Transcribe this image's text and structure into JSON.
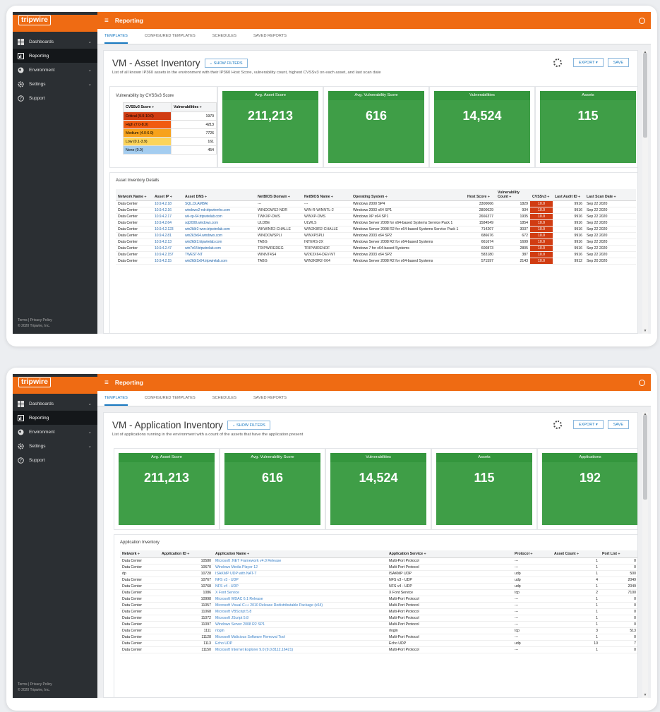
{
  "app": {
    "logo": "tripwire",
    "title": "Reporting",
    "brand_color": "#ef6b13",
    "sidebar": [
      {
        "label": "Dashboards",
        "icon": "dashboard-icon",
        "chevron": true
      },
      {
        "label": "Reporting",
        "icon": "report-icon",
        "chevron": false,
        "active": true
      },
      {
        "label": "Environment",
        "icon": "globe-icon",
        "chevron": true
      },
      {
        "label": "Settings",
        "icon": "gear-icon",
        "chevron": true
      },
      {
        "label": "Support",
        "icon": "help-icon",
        "chevron": false
      }
    ],
    "footer_links": "Terms | Privacy Policy",
    "footer_copy": "© 2020 Tripwire, Inc.",
    "tabs": [
      "TEMPLATES",
      "CONFIGURED TEMPLATES",
      "SCHEDULES",
      "SAVED REPORTS"
    ],
    "show_filters": "SHOW FILTERS",
    "export": "EXPORT",
    "save": "SAVE"
  },
  "report1": {
    "title": "VM - Asset Inventory",
    "description": "List of all known IP360 assets in the environment with their IP360 Host Score, vulnerability count, highest CVSSv3 on each asset, and last scan date",
    "cvss_title": "Vulnerability by CVSSv3 Score",
    "cvss_headers": [
      "CVSSv3 Score ÷",
      "Vulnerabilities ÷"
    ],
    "cvss_rows": [
      {
        "label": "Critical (9.0-10.0)",
        "value": "1970",
        "color": "#d13c12"
      },
      {
        "label": "High (7.0-8.9)",
        "value": "4213",
        "color": "#f15a10"
      },
      {
        "label": "Medium (4.0-6.9)",
        "value": "7726",
        "color": "#f7a21b"
      },
      {
        "label": "Low (0.1-3.9)",
        "value": "161",
        "color": "#fcd45a"
      },
      {
        "label": "None (0.0)",
        "value": "454",
        "color": "#a4cdf0"
      }
    ],
    "kpis": [
      {
        "label": "Avg. Asset Score",
        "value": "211,213"
      },
      {
        "label": "Avg. Vulnerability Score",
        "value": "616"
      },
      {
        "label": "Vulnerabilities",
        "value": "14,524"
      },
      {
        "label": "Assets",
        "value": "115"
      }
    ],
    "details_title": "Asset Inventory Details",
    "headers": [
      "Network Name ÷",
      "Asset IP ÷",
      "Asset DNS ÷",
      "NetBIOS Domain ÷",
      "NetBIOS Name ÷",
      "Operating System ÷",
      "Host Score ÷",
      "Vulnerability Count ÷",
      "CVSSv3 ÷",
      "Last Audit ID ÷",
      "Last Scan Date ÷"
    ],
    "rows": [
      [
        "Data Center",
        "10.9.4.2.18",
        "SQL.DLAMBAI",
        "---",
        "---",
        "Windows 2000 SP4",
        "3300066",
        "1829",
        "10.0",
        "9916",
        "Sep 22 2020"
      ],
      [
        "Data Center",
        "10.9.4.2.16",
        "windows2-ndr.tripwirenhs.com",
        "WINDOWS2-NDR",
        "WIN-R-WINNTL-2",
        "Windows 2003 x64 SP1",
        "2800629",
        "934",
        "10.0",
        "9916",
        "Sep 22 2020"
      ],
      [
        "Data Center",
        "10.9.4.2.17",
        "wk-xp-64.tripwirelab.com",
        "TWKXP-DMS",
        "WINXP-DMS",
        "Windows XP x64 SP1",
        "2666377",
        "1935",
        "10.0",
        "9916",
        "Sep 22 2020"
      ],
      [
        "Data Center",
        "10.9.4.2.64",
        "sql2008.windows.com",
        "ULDBE",
        "ULWLS",
        "Windows Server 2008 for x64-based Systems Service Pack 1",
        "1584549",
        "1854",
        "10.0",
        "9916",
        "Sep 22 2020"
      ],
      [
        "Data Center",
        "10.9.4.2.123",
        "win2k8r2-wsrc.tripwirelab.com",
        "WKWINR2-CHALLE",
        "WIN2K8R2-CHALLE",
        "Windows Server 2008 R2 for x64-based Systems Service Pack 1",
        "714207",
        "3037",
        "10.0",
        "9916",
        "Sep 22 2020"
      ],
      [
        "Data Center",
        "10.9.4.2.81",
        "win2k3x64.windows.com",
        "WINDOWSPLI",
        "WINXPSPLI",
        "Windows 2003 x64 SP2",
        "686676",
        "672",
        "10.0",
        "9916",
        "Sep 22 2020"
      ],
      [
        "Data Center",
        "10.9.4.2.13",
        "win2k8r2.tripwirelab.com",
        "TABG",
        "INTERS-2X",
        "Windows Server 2008 R2 for x64-based Systems",
        "661674",
        "1699",
        "10.0",
        "9916",
        "Sep 22 2020"
      ],
      [
        "Data Center",
        "10.9.4.2.47",
        "win7x64.tripwirelab.com",
        "TRIPWIREDEG",
        "TRIPWIRENOF",
        "Windows 7 for x64-based Systems",
        "600873",
        "2805",
        "10.0",
        "9916",
        "Sep 22 2020"
      ],
      [
        "Data Center",
        "10.9.4.2.157",
        "TWEST-NT",
        "WINNT4S4",
        "W2K3X64-DEV-NT",
        "Windows 2003 x64 SP2",
        "583180",
        "387",
        "10.0",
        "9916",
        "Sep 22 2020"
      ],
      [
        "Data Center",
        "10.9.4.2.15",
        "win2k8r2x64.tripwirelab.com",
        "TABG",
        "WIN2K8R2-X64",
        "Windows Server 2008 R2 for x64-based Systems",
        "571597",
        "2143",
        "10.0",
        "9912",
        "Sep 20 2020"
      ]
    ]
  },
  "report2": {
    "title": "VM - Application Inventory",
    "description": "List of applications running in the environment with a count of the assets that have the application present",
    "kpis": [
      {
        "label": "Avg. Asset Score",
        "value": "211,213"
      },
      {
        "label": "Avg. Vulnerability Score",
        "value": "616"
      },
      {
        "label": "Vulnerabilities",
        "value": "14,524"
      },
      {
        "label": "Assets",
        "value": "115"
      },
      {
        "label": "Applications",
        "value": "192"
      }
    ],
    "details_title": "Application Inventory",
    "headers": [
      "Network ÷",
      "Application ID ÷",
      "Application Name ÷",
      "Application Service ÷",
      "Protocol ÷",
      "Asset Count ÷",
      "Port List ÷"
    ],
    "rows": [
      [
        "Data Center",
        "10580",
        "Microsoft .NET Framework v4.0 Release",
        "Multi-Port Protocol",
        "---",
        "1",
        "0"
      ],
      [
        "Data Center",
        "10670",
        "Windows Media Player 12",
        "Multi-Port Protocol",
        "---",
        "1",
        "0"
      ],
      [
        "dp",
        "10728",
        "ISAKMP UDP with NAT-T",
        "ISAKMP UDP",
        "udp",
        "1",
        "500"
      ],
      [
        "Data Center",
        "10767",
        "NFS v3 - UDP",
        "NFS v3 - UDP",
        "udp",
        "4",
        "2049"
      ],
      [
        "Data Center",
        "10768",
        "NFS v4 - UDP",
        "NFS v4 - UDP",
        "udp",
        "1",
        "2049"
      ],
      [
        "Data Center",
        "1086",
        "X Font Service",
        "X Font Service",
        "tcp",
        "2",
        "7100"
      ],
      [
        "Data Center",
        "10998",
        "Microsoft WDAC 6.1 Release",
        "Multi-Port Protocol",
        "---",
        "1",
        "0"
      ],
      [
        "Data Center",
        "11057",
        "Microsoft Visual C++ 2010 Release Redistributable Package (x64)",
        "Multi-Port Protocol",
        "---",
        "1",
        "0"
      ],
      [
        "Data Center",
        "11068",
        "Microsoft VBScript 5.8",
        "Multi-Port Protocol",
        "---",
        "1",
        "0"
      ],
      [
        "Data Center",
        "11072",
        "Microsoft JScript 5.8",
        "Multi-Port Protocol",
        "---",
        "1",
        "0"
      ],
      [
        "Data Center",
        "11097",
        "Windows Server 2008 R2 SP1",
        "Multi-Port Protocol",
        "---",
        "1",
        "0"
      ],
      [
        "Data Center",
        "1111",
        "rlogin",
        "rlogin",
        "tcp",
        "3",
        "513"
      ],
      [
        "Data Center",
        "11128",
        "Microsoft Malicious Software Removal Tool",
        "Multi-Port Protocol",
        "---",
        "1",
        "0"
      ],
      [
        "Data Center",
        "1113",
        "Echo UDP",
        "Echo UDP",
        "udp",
        "10",
        "7"
      ],
      [
        "Data Center",
        "11150",
        "Microsoft Internet Explorer 9.0 (9.0.8112.16421)",
        "Multi-Port Protocol",
        "---",
        "1",
        "0"
      ]
    ]
  }
}
